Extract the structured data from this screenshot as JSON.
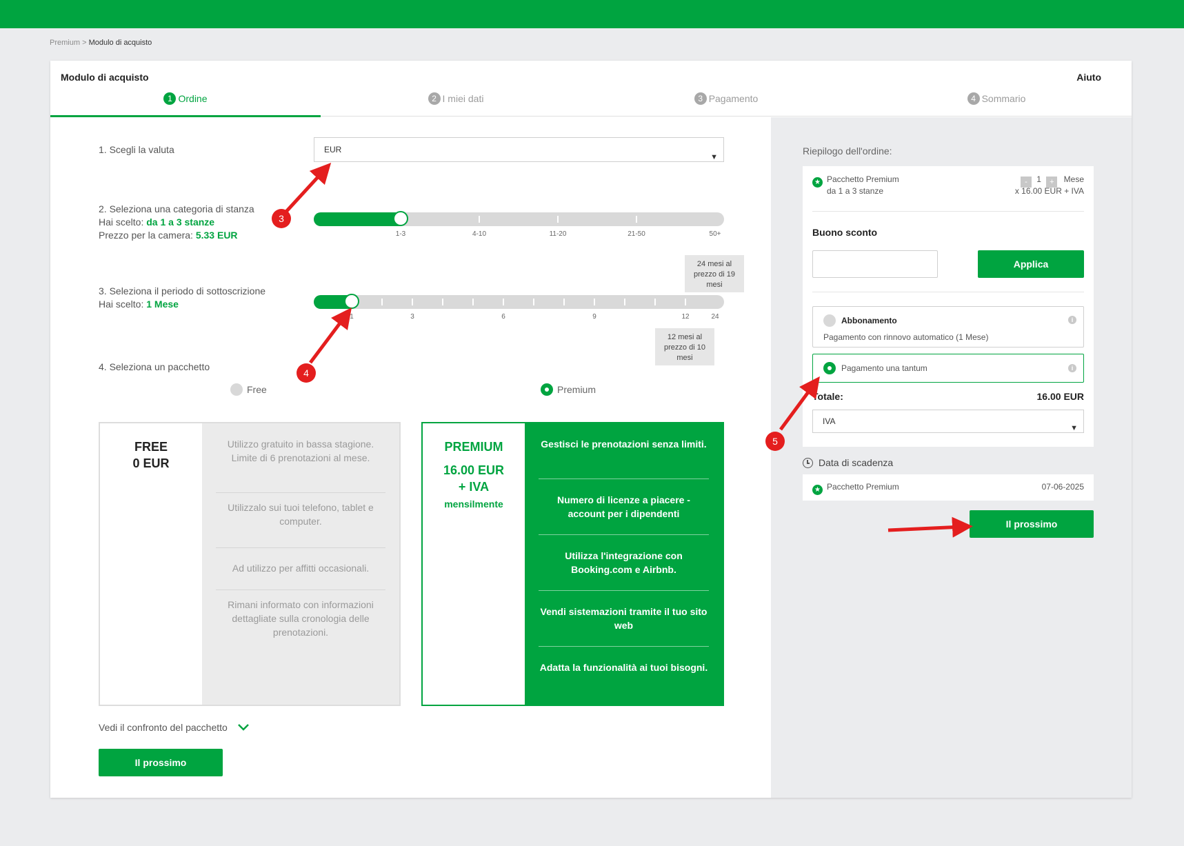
{
  "breadcrumb": {
    "parent": "Premium",
    "sep": " > ",
    "current": "Modulo di acquisto"
  },
  "header": {
    "title": "Modulo di acquisto",
    "help": "Aiuto"
  },
  "steps": [
    {
      "num": "1",
      "label": "Ordine"
    },
    {
      "num": "2",
      "label": "I miei dati"
    },
    {
      "num": "3",
      "label": "Pagamento"
    },
    {
      "num": "4",
      "label": "Sommario"
    }
  ],
  "currency": {
    "label": "1. Scegli la valuta",
    "value": "EUR"
  },
  "rooms": {
    "label": "2. Seleziona una categoria di stanza",
    "chosen_prefix": "Hai scelto: ",
    "chosen": "da 1 a 3 stanze",
    "price_prefix": "Prezzo per la camera: ",
    "price": "5.33 EUR",
    "ticks": [
      "1-3",
      "4-10",
      "11-20",
      "21-50",
      "50+"
    ],
    "selected_index": 0
  },
  "period": {
    "label": "3. Seleziona il periodo di sottoscrizione",
    "chosen_prefix": "Hai scelto: ",
    "chosen": "1 Mese",
    "tick_labels": [
      "1",
      "3",
      "6",
      "9",
      "12",
      "24"
    ],
    "promo_24": "24 mesi al prezzo di 19 mesi",
    "promo_12": "12 mesi al prezzo di 10 mesi"
  },
  "package": {
    "label": "4. Seleziona un pacchetto",
    "options": [
      "Free",
      "Premium"
    ],
    "selected": "Premium"
  },
  "free_pkg": {
    "name": "FREE",
    "price": "0 EUR",
    "features": [
      "Utilizzo gratuito in bassa stagione. Limite di 6 prenotazioni al mese.",
      "Utilizzalo sui tuoi telefono, tablet e computer.",
      "Ad utilizzo per affitti occasionali.",
      "Rimani informato con informazioni dettagliate sulla cronologia delle prenotazioni."
    ]
  },
  "premium_pkg": {
    "name": "PREMIUM",
    "price_line1": "16.00 EUR",
    "price_line2": "+ IVA",
    "period": "mensilmente",
    "features": [
      "Gestisci le prenotazioni senza limiti.",
      "Numero di licenze a piacere - account per i dipendenti",
      "Utilizza l'integrazione con Booking.com e Airbnb.",
      "Vendi sistemazioni tramite il tuo sito web",
      "Adatta la funzionalità ai tuoi bisogni."
    ]
  },
  "compare_link": "Vedi il confronto del pacchetto",
  "next_label": "Il prossimo",
  "summary": {
    "title": "Riepilogo dell'ordine:",
    "item_name": "Pacchetto Premium",
    "item_sub": "da 1 a 3 stanze",
    "qty_minus": "-",
    "qty": "1",
    "qty_plus": "+",
    "qty_unit": "Mese",
    "unit_price": "x 16.00 EUR + IVA",
    "coupon_label": "Buono sconto",
    "coupon_placeholder": "",
    "apply": "Applica",
    "subscription_title": "Abbonamento",
    "subscription_desc": "Pagamento con rinnovo automatico (1 Mese)",
    "onetime": "Pagamento una tantum",
    "total_label": "Totale:",
    "total_value": "16.00 EUR",
    "vat_select": "IVA",
    "expiry_label": "Data di scadenza",
    "expiry_item": "Pacchetto Premium",
    "expiry_date": "07-06-2025",
    "next": "Il prossimo"
  },
  "annotations": [
    "3",
    "4",
    "5"
  ],
  "colors": {
    "brand": "#00a440",
    "marker": "#e41e1e",
    "background": "#ebecee"
  }
}
